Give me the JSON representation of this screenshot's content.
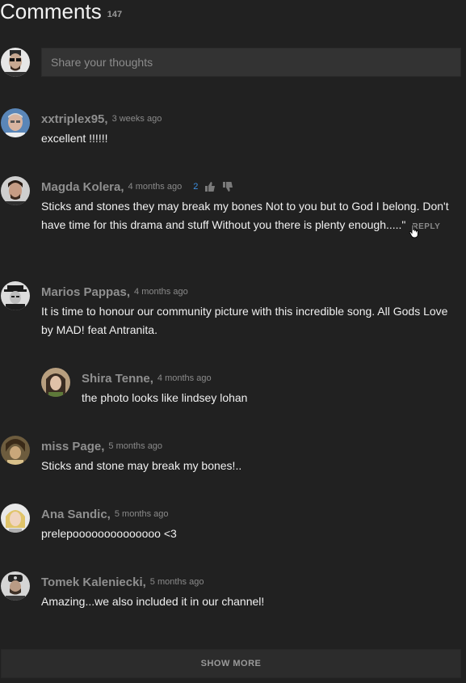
{
  "header": {
    "title": "Comments",
    "count": "147"
  },
  "composer": {
    "placeholder": "Share your thoughts"
  },
  "comments": [
    {
      "author": "xxtriplex95,",
      "time": "3 weeks ago",
      "text": "excellent !!!!!!"
    },
    {
      "author": "Magda Kolera,",
      "time": "4 months ago",
      "likes": "2",
      "text": "Sticks and stones they may break my bones  Not to you but to God I belong. Don't have time for this drama and stuff Without you there is plenty enough.....\"",
      "reply": "REPLY"
    },
    {
      "author": "Marios Pappas,",
      "time": "4 months ago",
      "text": "It is time to honour our community picture with this incredible song. All Gods Love by MAD! feat Antranita."
    },
    {
      "author": "Shira Tenne,",
      "time": "4 months ago",
      "text": "the photo looks like lindsey lohan"
    },
    {
      "author": "miss Page,",
      "time": "5 months ago",
      "text": "Sticks and stone may break my bones!.."
    },
    {
      "author": "Ana Sandic,",
      "time": "5 months ago",
      "text": "prelepoooooooooooooo <3"
    },
    {
      "author": "Tomek Kaleniecki,",
      "time": "5 months ago",
      "text": "Amazing...we also included it in our channel!"
    }
  ],
  "show_more": "SHOW MORE",
  "icons": {
    "like": "thumbs-up-icon",
    "dislike": "thumbs-down-icon",
    "cursor": "hand-pointer-icon"
  },
  "colors": {
    "background": "#212121",
    "accent": "#3d8fe0",
    "author": "#8f8f8f"
  }
}
